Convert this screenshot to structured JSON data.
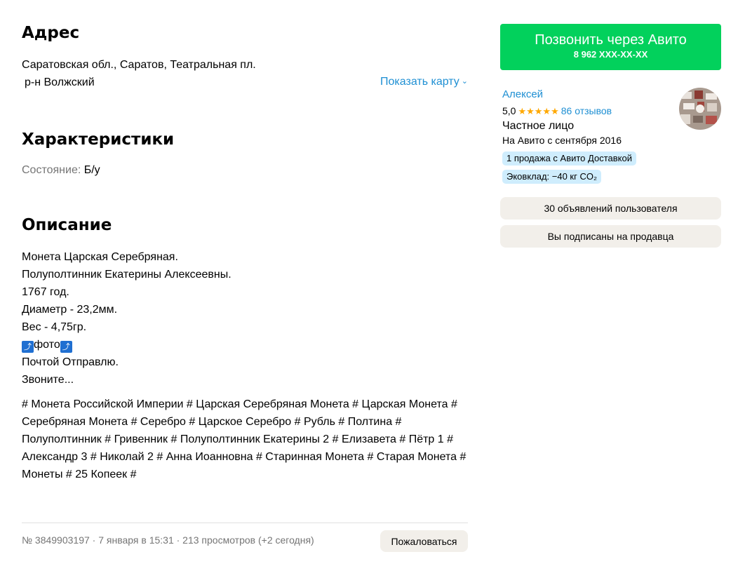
{
  "address": {
    "heading": "Адрес",
    "line1": "Саратовская обл., Саратов, Театральная пл.",
    "district": "р-н Волжский",
    "show_map": "Показать карту"
  },
  "characteristics": {
    "heading": "Характеристики",
    "condition_label": "Состояние:",
    "condition_value": "Б/у"
  },
  "description": {
    "heading": "Описание",
    "lines": [
      "Монета Царская Серебряная.",
      "Полуполтинник Екатерины Алексеевны.",
      "1767 год.",
      "Диаметр - 23,2мм.",
      "Вес - 4,75гр."
    ],
    "photo_word": "фото",
    "photo_arrow": "⤴",
    "line_after_photo_1": "Почтой Отправлю.",
    "line_after_photo_2": "Звоните...",
    "tags": "# Монета Российской Империи # Царская Серебряная Монета # Царская Монета # Серебряная Монета # Серебро # Царское Серебро # Рубль # Полтина # Полуполтинник # Гривенник # Полуполтинник Екатерины 2 # Елизавета # Пётр 1 # Александр 3 # Николай 2 # Анна Иоанновна # Старинная Монета # Старая Монета # Монеты # 25 Копеек #"
  },
  "footer": {
    "meta": "№ 3849903197 · 7 января в 15:31 · 213 просмотров (+2 сегодня)",
    "complain": "Пожаловаться"
  },
  "seller": {
    "call_button": "Позвонить через Авито",
    "phone": "8 962 XXX-XX-XX",
    "name": "Алексей",
    "rating": "5,0",
    "stars": "★★★★★",
    "reviews": "86 отзывов",
    "type": "Частное лицо",
    "since": "На Авито с сентября 2016",
    "badge_delivery": "1 продажа с Авито Доставкой",
    "badge_eco": "Эковклад: −40 кг CO₂",
    "listings_button": "30 объявлений пользователя",
    "subscribed_button": "Вы подписаны на продавца"
  },
  "colors": {
    "call_green": "#02d15c",
    "link_blue": "#1e8fd3",
    "star_orange": "#ffa800",
    "badge_blue": "#cfedfd",
    "button_beige": "#f2efea"
  }
}
